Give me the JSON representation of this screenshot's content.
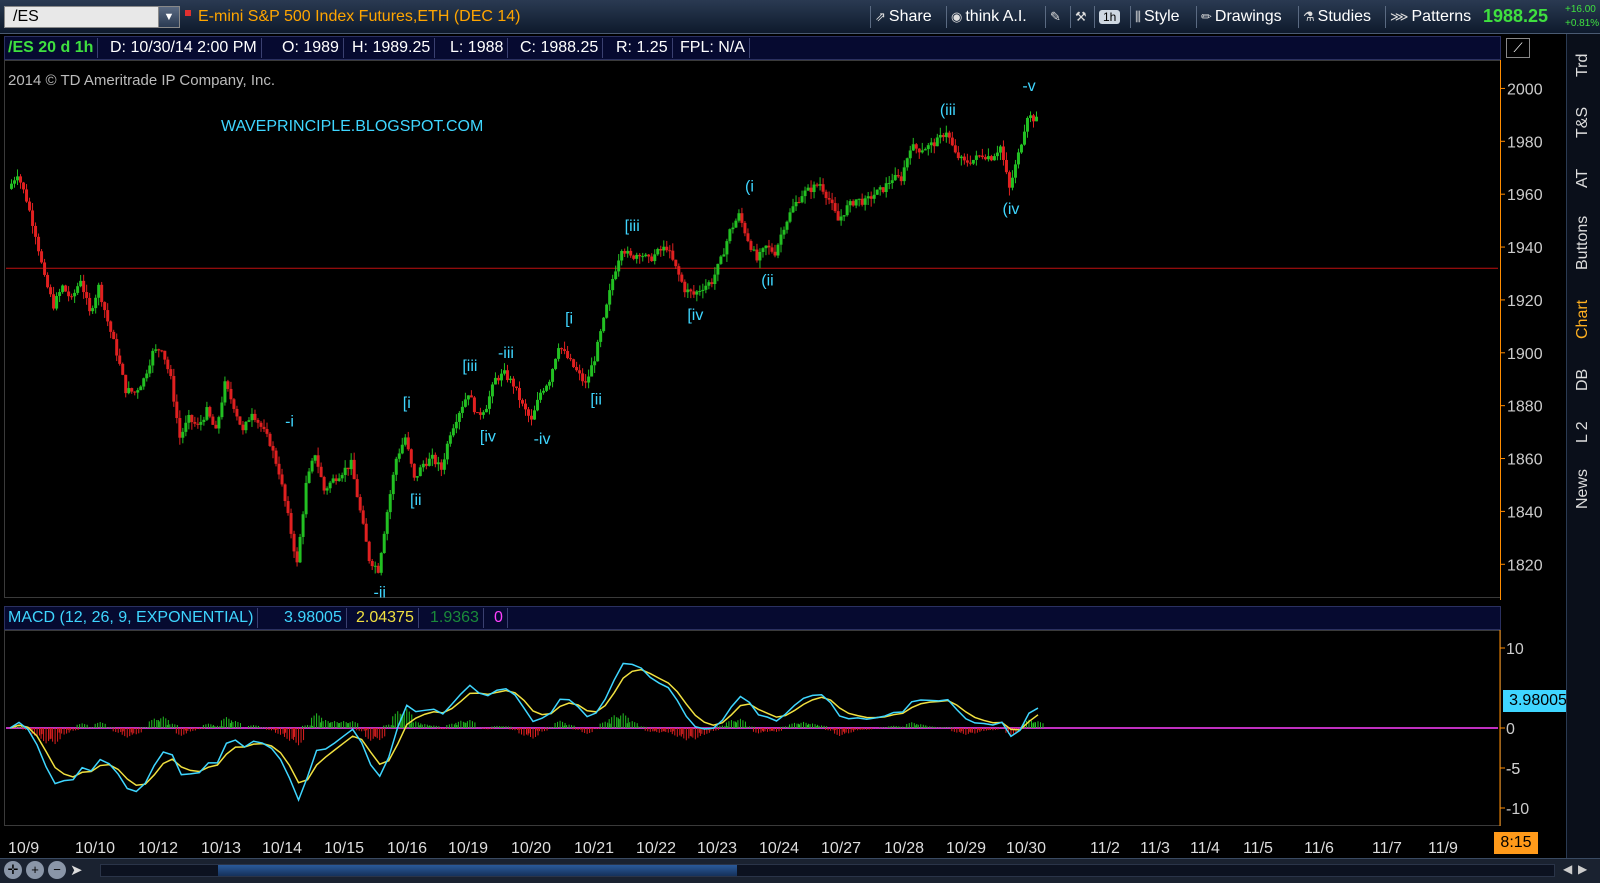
{
  "toolbar": {
    "symbol": "/ES",
    "instrument_title": "E-mini S&P 500 Index Futures,ETH (DEC 14)",
    "share_label": "Share",
    "thinkai_label": "think A.I.",
    "timeframe_badge": "1h",
    "style_label": "Style",
    "drawings_label": "Drawings",
    "studies_label": "Studies",
    "patterns_label": "Patterns",
    "last_price": "1988.25",
    "net_change": "+16.00",
    "pct_change": "+0.81%"
  },
  "infobar": {
    "symbol_period": "/ES 20 d 1h",
    "date": "D: 10/30/14 2:00 PM",
    "open": "O: 1989",
    "high": "H: 1989.25",
    "low": "L: 1988",
    "close": "C: 1988.25",
    "range": "R: 1.25",
    "fpl": "FPL: N/A"
  },
  "chart_overlay": {
    "copyright": "2014 © TD Ameritrade IP Company, Inc.",
    "blog_watermark": "WAVEPRINCIPLE.BLOGSPOT.COM"
  },
  "macd_header": {
    "study": "MACD (12, 26, 9, EXPONENTIAL)",
    "value": "3.98005",
    "avg": "2.04375",
    "diff": "1.9363",
    "zero": "0"
  },
  "macd_value_tag": "3.98005",
  "time_tag": "8:15",
  "sidebar_tabs": [
    "Trd",
    "T&S",
    "AT",
    "Buttons",
    "Chart",
    "DB",
    "L 2",
    "News"
  ],
  "active_tab": "Chart",
  "colors": {
    "up": "#22c022",
    "down": "#e02020",
    "macd_line": "#3fd6ff",
    "signal_line": "#f0e040",
    "zero_line": "#ff40ff",
    "hline": "#c01010",
    "wave_label": "#3fd6ff",
    "axis": "#ff8c00"
  },
  "chart_data": {
    "type": "candlestick",
    "price_axis_ticks": [
      1820,
      1840,
      1860,
      1880,
      1900,
      1920,
      1940,
      1960,
      1980,
      2000
    ],
    "ylim": [
      1808,
      2010
    ],
    "date_ticks": [
      "10/9",
      "10/10",
      "10/12",
      "10/13",
      "10/14",
      "10/15",
      "10/16",
      "10/19",
      "10/20",
      "10/21",
      "10/22",
      "10/23",
      "10/24",
      "10/27",
      "10/28",
      "10/29",
      "10/30",
      "11/2",
      "11/3",
      "11/4",
      "11/5",
      "11/6",
      "11/7",
      "11/9"
    ],
    "horizontal_line": 1932,
    "price_path": [
      {
        "d": "10/9",
        "p": 1962
      },
      {
        "d": "10/9",
        "p": 1968
      },
      {
        "d": "10/9",
        "p": 1958
      },
      {
        "d": "10/9",
        "p": 1945
      },
      {
        "d": "10/9",
        "p": 1928
      },
      {
        "d": "10/10",
        "p": 1918
      },
      {
        "d": "10/10",
        "p": 1925
      },
      {
        "d": "10/10",
        "p": 1920
      },
      {
        "d": "10/10",
        "p": 1928
      },
      {
        "d": "10/10",
        "p": 1915
      },
      {
        "d": "10/10",
        "p": 1925
      },
      {
        "d": "10/10",
        "p": 1912
      },
      {
        "d": "10/10",
        "p": 1900
      },
      {
        "d": "10/12",
        "p": 1886
      },
      {
        "d": "10/12",
        "p": 1885
      },
      {
        "d": "10/12",
        "p": 1890
      },
      {
        "d": "10/12",
        "p": 1900
      },
      {
        "d": "10/12",
        "p": 1902
      },
      {
        "d": "10/12",
        "p": 1890
      },
      {
        "d": "10/13",
        "p": 1868
      },
      {
        "d": "10/13",
        "p": 1875
      },
      {
        "d": "10/13",
        "p": 1872
      },
      {
        "d": "10/13",
        "p": 1878
      },
      {
        "d": "10/13",
        "p": 1870
      },
      {
        "d": "10/13",
        "p": 1888
      },
      {
        "d": "10/13",
        "p": 1880
      },
      {
        "d": "10/14",
        "p": 1870
      },
      {
        "d": "10/14",
        "p": 1878
      },
      {
        "d": "10/14",
        "p": 1872
      },
      {
        "d": "10/14",
        "p": 1866
      },
      {
        "d": "10/14",
        "p": 1855
      },
      {
        "d": "10/14",
        "p": 1838
      },
      {
        "d": "10/14",
        "p": 1820
      },
      {
        "d": "10/14",
        "p": 1850
      },
      {
        "d": "10/15",
        "p": 1862
      },
      {
        "d": "10/15",
        "p": 1848
      },
      {
        "d": "10/15",
        "p": 1852
      },
      {
        "d": "10/15",
        "p": 1855
      },
      {
        "d": "10/15",
        "p": 1858
      },
      {
        "d": "10/15",
        "p": 1840
      },
      {
        "d": "10/15",
        "p": 1822
      },
      {
        "d": "10/15",
        "p": 1818
      },
      {
        "d": "10/15",
        "p": 1840
      },
      {
        "d": "10/15",
        "p": 1860
      },
      {
        "d": "10/16",
        "p": 1868
      },
      {
        "d": "10/16",
        "p": 1852
      },
      {
        "d": "10/16",
        "p": 1858
      },
      {
        "d": "10/16",
        "p": 1860
      },
      {
        "d": "10/16",
        "p": 1856
      },
      {
        "d": "10/16",
        "p": 1870
      },
      {
        "d": "10/16",
        "p": 1878
      },
      {
        "d": "10/16",
        "p": 1885
      },
      {
        "d": "10/16",
        "p": 1876
      },
      {
        "d": "10/19",
        "p": 1880
      },
      {
        "d": "10/19",
        "p": 1890
      },
      {
        "d": "10/19",
        "p": 1892
      },
      {
        "d": "10/19",
        "p": 1888
      },
      {
        "d": "10/19",
        "p": 1880
      },
      {
        "d": "10/19",
        "p": 1874
      },
      {
        "d": "10/19",
        "p": 1885
      },
      {
        "d": "10/19",
        "p": 1890
      },
      {
        "d": "10/19",
        "p": 1903
      },
      {
        "d": "10/20",
        "p": 1898
      },
      {
        "d": "10/20",
        "p": 1893
      },
      {
        "d": "10/20",
        "p": 1888
      },
      {
        "d": "10/20",
        "p": 1898
      },
      {
        "d": "10/20",
        "p": 1912
      },
      {
        "d": "10/20",
        "p": 1928
      },
      {
        "d": "10/20",
        "p": 1940
      },
      {
        "d": "10/21",
        "p": 1936
      },
      {
        "d": "10/21",
        "p": 1938
      },
      {
        "d": "10/21",
        "p": 1935
      },
      {
        "d": "10/21",
        "p": 1938
      },
      {
        "d": "10/21",
        "p": 1940
      },
      {
        "d": "10/21",
        "p": 1932
      },
      {
        "d": "10/21",
        "p": 1924
      },
      {
        "d": "10/22",
        "p": 1922
      },
      {
        "d": "10/22",
        "p": 1925
      },
      {
        "d": "10/22",
        "p": 1927
      },
      {
        "d": "10/22",
        "p": 1935
      },
      {
        "d": "10/22",
        "p": 1946
      },
      {
        "d": "10/22",
        "p": 1952
      },
      {
        "d": "10/23",
        "p": 1943
      },
      {
        "d": "10/23",
        "p": 1935
      },
      {
        "d": "10/23",
        "p": 1940
      },
      {
        "d": "10/23",
        "p": 1938
      },
      {
        "d": "10/23",
        "p": 1948
      },
      {
        "d": "10/23",
        "p": 1955
      },
      {
        "d": "10/24",
        "p": 1960
      },
      {
        "d": "10/24",
        "p": 1962
      },
      {
        "d": "10/24",
        "p": 1964
      },
      {
        "d": "10/24",
        "p": 1958
      },
      {
        "d": "10/24",
        "p": 1950
      },
      {
        "d": "10/24",
        "p": 1955
      },
      {
        "d": "10/27",
        "p": 1958
      },
      {
        "d": "10/27",
        "p": 1957
      },
      {
        "d": "10/27",
        "p": 1960
      },
      {
        "d": "10/27",
        "p": 1962
      },
      {
        "d": "10/27",
        "p": 1966
      },
      {
        "d": "10/27",
        "p": 1966
      },
      {
        "d": "10/28",
        "p": 1978
      },
      {
        "d": "10/28",
        "p": 1977
      },
      {
        "d": "10/28",
        "p": 1978
      },
      {
        "d": "10/28",
        "p": 1980
      },
      {
        "d": "10/28",
        "p": 1984
      },
      {
        "d": "10/28",
        "p": 1975
      },
      {
        "d": "10/29",
        "p": 1972
      },
      {
        "d": "10/29",
        "p": 1973
      },
      {
        "d": "10/29",
        "p": 1975
      },
      {
        "d": "10/29",
        "p": 1974
      },
      {
        "d": "10/29",
        "p": 1978
      },
      {
        "d": "10/29",
        "p": 1962
      },
      {
        "d": "10/30",
        "p": 1975
      },
      {
        "d": "10/30",
        "p": 1990
      },
      {
        "d": "10/30",
        "p": 1988
      }
    ],
    "wave_labels": [
      {
        "t": "-i",
        "i": 31,
        "p": 1869,
        "pos": "above"
      },
      {
        "t": "-ii",
        "i": 41,
        "p": 1815,
        "pos": "below"
      },
      {
        "t": "[i",
        "i": 44,
        "p": 1876,
        "pos": "above"
      },
      {
        "t": "[ii",
        "i": 45,
        "p": 1850,
        "pos": "below"
      },
      {
        "t": "[iii",
        "i": 51,
        "p": 1890,
        "pos": "above"
      },
      {
        "t": "[iv",
        "i": 53,
        "p": 1874,
        "pos": "below"
      },
      {
        "t": "-iii",
        "i": 55,
        "p": 1895,
        "pos": "above"
      },
      {
        "t": "-iv",
        "i": 59,
        "p": 1873,
        "pos": "below"
      },
      {
        "t": "[i",
        "i": 62,
        "p": 1908,
        "pos": "above"
      },
      {
        "t": "[ii",
        "i": 65,
        "p": 1888,
        "pos": "below"
      },
      {
        "t": "[iii",
        "i": 69,
        "p": 1943,
        "pos": "above"
      },
      {
        "t": "[iv",
        "i": 76,
        "p": 1920,
        "pos": "below"
      },
      {
        "t": "(i",
        "i": 82,
        "p": 1958,
        "pos": "above"
      },
      {
        "t": "(ii",
        "i": 84,
        "p": 1933,
        "pos": "below"
      },
      {
        "t": "(iii",
        "i": 104,
        "p": 1987,
        "pos": "above"
      },
      {
        "t": "(iv",
        "i": 111,
        "p": 1960,
        "pos": "below"
      },
      {
        "t": "-v",
        "i": 113,
        "p": 1996,
        "pos": "above"
      }
    ],
    "macd": {
      "axis_ticks": [
        10,
        5,
        0,
        -5,
        -10
      ],
      "ylim": [
        -12,
        12
      ],
      "label_ticks": [
        "10",
        "5",
        "0",
        "-5",
        "-10"
      ]
    }
  }
}
